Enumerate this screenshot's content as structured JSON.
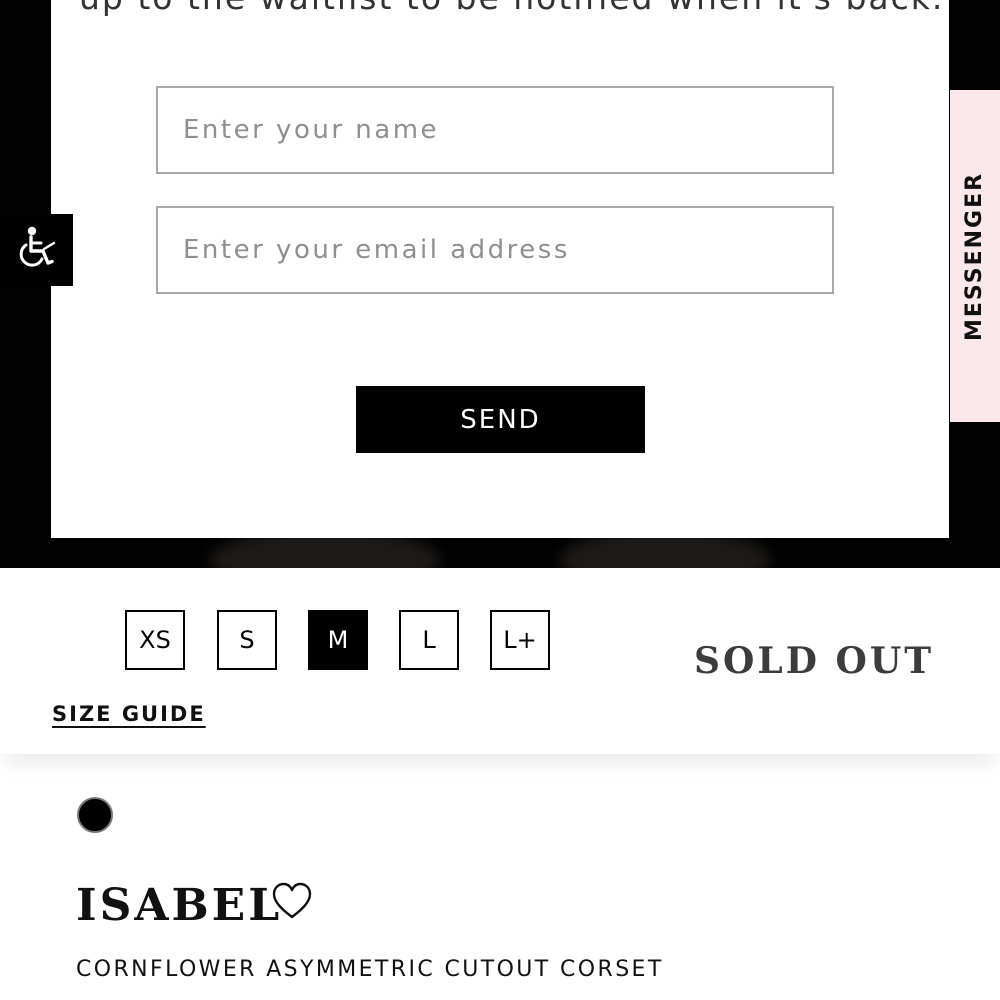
{
  "waitlist_modal": {
    "message_text": "up to the waitlist to be notified when it's back.",
    "name_placeholder": "Enter your name",
    "email_placeholder": "Enter your email address",
    "name_value": "",
    "email_value": "",
    "send_label": "SEND"
  },
  "accessibility": {
    "icon": "wheelchair-icon"
  },
  "messenger": {
    "label": "MESSENGER",
    "bg_color": "#fbe8ea"
  },
  "sizes": {
    "options": [
      "XS",
      "S",
      "M",
      "L",
      "L+"
    ],
    "selected": "M",
    "status": "SOLD OUT",
    "size_guide_label": "SIZE GUIDE"
  },
  "product": {
    "swatch_color": "#000000",
    "name": "ISABEL",
    "favorite_icon": "heart-outline-icon",
    "subtitle": "CORNFLOWER ASYMMETRIC CUTOUT CORSET"
  }
}
